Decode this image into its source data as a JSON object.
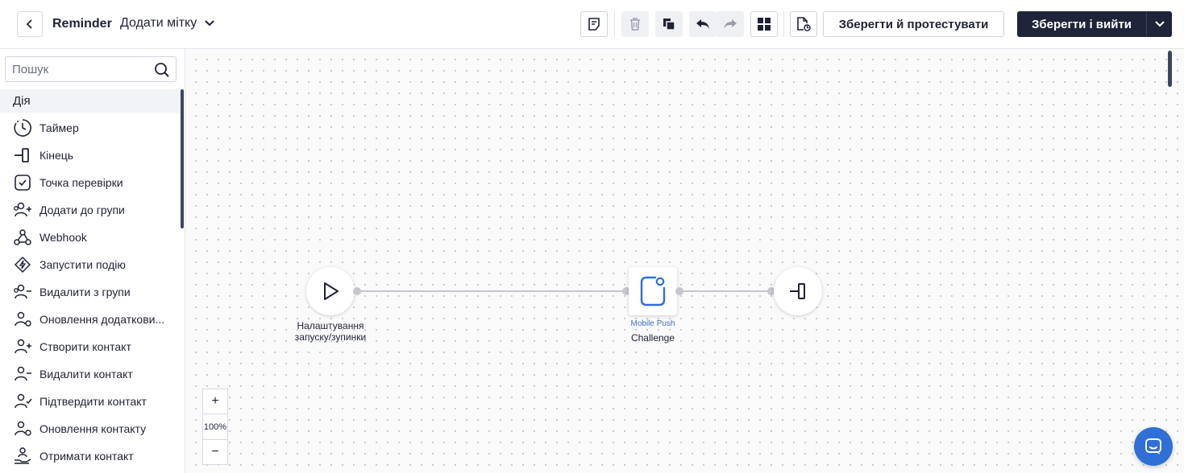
{
  "header": {
    "title": "Reminder",
    "add_tag_label": "Додати мітку",
    "save_test_label": "Зберегти й протестувати",
    "save_exit_label": "Зберегти і вийти"
  },
  "sidebar": {
    "search_placeholder": "Пошук",
    "section": "Дія",
    "items": [
      {
        "label": "Таймер",
        "icon": "timer-icon"
      },
      {
        "label": "Кінець",
        "icon": "end-icon"
      },
      {
        "label": "Точка перевірки",
        "icon": "checkpoint-icon"
      },
      {
        "label": "Додати до групи",
        "icon": "add-to-group-icon"
      },
      {
        "label": "Webhook",
        "icon": "webhook-icon"
      },
      {
        "label": "Запустити подію",
        "icon": "trigger-event-icon"
      },
      {
        "label": "Видалити з групи",
        "icon": "remove-from-group-icon"
      },
      {
        "label": "Оновлення додаткови...",
        "icon": "update-extra-icon"
      },
      {
        "label": "Створити контакт",
        "icon": "create-contact-icon"
      },
      {
        "label": "Видалити контакт",
        "icon": "delete-contact-icon"
      },
      {
        "label": "Підтвердити контакт",
        "icon": "confirm-contact-icon"
      },
      {
        "label": "Оновлення контакту",
        "icon": "update-contact-icon"
      },
      {
        "label": "Отримати контакт",
        "icon": "get-contact-icon"
      }
    ]
  },
  "canvas": {
    "start_label_line1": "Налаштування",
    "start_label_line2": "запуску/зупинки",
    "push_type": "Mobile Push",
    "push_name": "Challenge",
    "zoom_in": "+",
    "zoom_level": "100%",
    "zoom_out": "−"
  }
}
